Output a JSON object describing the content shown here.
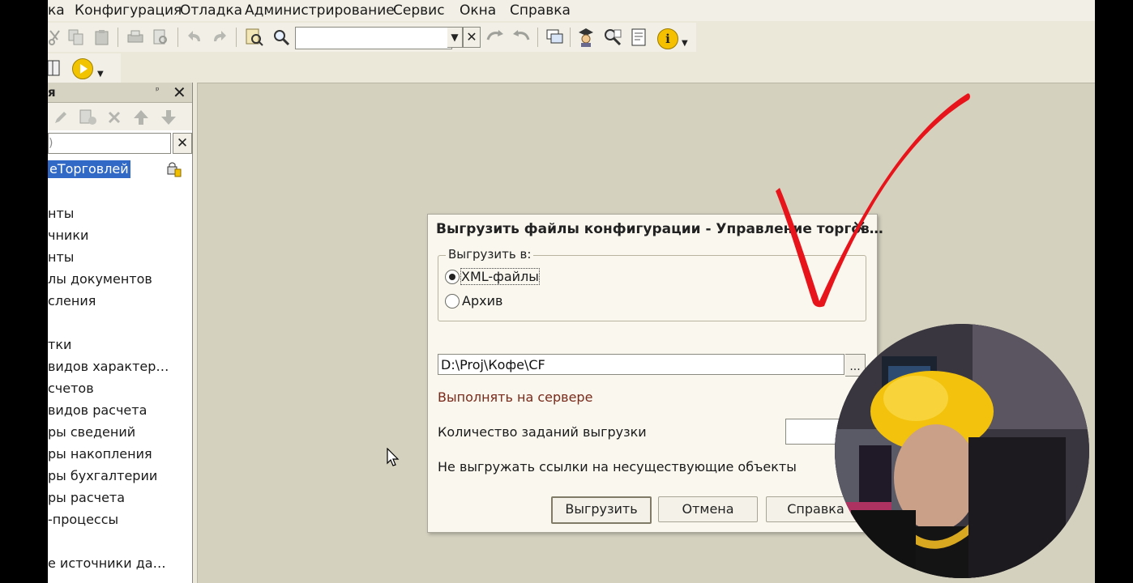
{
  "menu": {
    "items": [
      "ка",
      "Конфигурация",
      "Отладка",
      "Администрирование",
      "Сервис",
      "Окна",
      "Справка"
    ]
  },
  "toolbar": {
    "search_value": ""
  },
  "left_panel": {
    "title": "я",
    "search_value": ")",
    "root": "еТорговлей",
    "items": [
      "нты",
      "чники",
      "нты",
      "лы документов",
      "сления",
      "тки",
      "видов характер…",
      "счетов",
      "видов расчета",
      "ры сведений",
      "ры накопления",
      "ры бухгалтерии",
      "ры расчета",
      "-процессы",
      "е источники да…"
    ]
  },
  "dialog": {
    "title": "Выгрузить файлы конфигурации - Управление торгов…",
    "group_label": "Выгрузить в:",
    "options": [
      "XML-файлы",
      "Архив"
    ],
    "selected_option": "XML-файлы",
    "path_value": "D:\\Proj\\Кофе\\CF",
    "path_button": "...",
    "server_link": "Выполнять на сервере",
    "count_label": "Количество заданий выгрузки",
    "count_value": "",
    "noref_label": "Не выгружать ссылки на несуществующие объекты",
    "buttons": {
      "export": "Выгрузить",
      "cancel": "Отмена",
      "help": "Справка"
    }
  },
  "colors": {
    "selection": "#3169c6",
    "workspace": "#d5d1bf",
    "annotation_check": "#e8141c",
    "link": "#7a2a1a"
  },
  "overlay": {
    "annotation": "red-checkmark",
    "webcam": "presenter-webcam"
  }
}
